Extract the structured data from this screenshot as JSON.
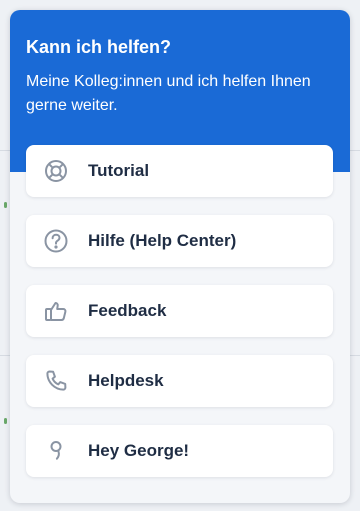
{
  "colors": {
    "header_bg": "#1a6ad6",
    "card_bg": "#ffffff",
    "panel_bg": "#f4f6f9",
    "label_text": "#1f2d44",
    "icon_stroke": "#8a94a3"
  },
  "header": {
    "title": "Kann ich helfen?",
    "subtitle": "Meine Kolleg:innen und ich helfen Ihnen gerne weiter."
  },
  "menu": {
    "items": [
      {
        "label": "Tutorial",
        "icon": "lifebuoy-icon"
      },
      {
        "label": "Hilfe (Help Center)",
        "icon": "question-circle-icon"
      },
      {
        "label": "Feedback",
        "icon": "thumbs-up-icon"
      },
      {
        "label": "Helpdesk",
        "icon": "phone-icon"
      },
      {
        "label": "Hey George!",
        "icon": "george-icon"
      }
    ]
  }
}
